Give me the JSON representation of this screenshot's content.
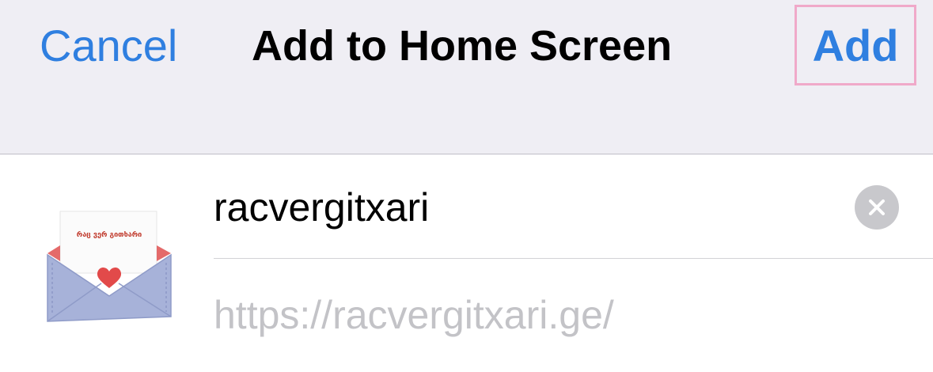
{
  "header": {
    "cancel_label": "Cancel",
    "title": "Add to Home Screen",
    "add_label": "Add"
  },
  "bookmark": {
    "name_value": "racvergitxari",
    "url": "https://racvergitxari.ge/",
    "icon": "envelope-heart-icon",
    "icon_card_text": "რაც ვერ გითხარი"
  },
  "colors": {
    "accent": "#2f7fe0",
    "highlight_border": "#f0a9c9",
    "nav_background": "#efeef4",
    "url_text": "#c3c3c7"
  }
}
